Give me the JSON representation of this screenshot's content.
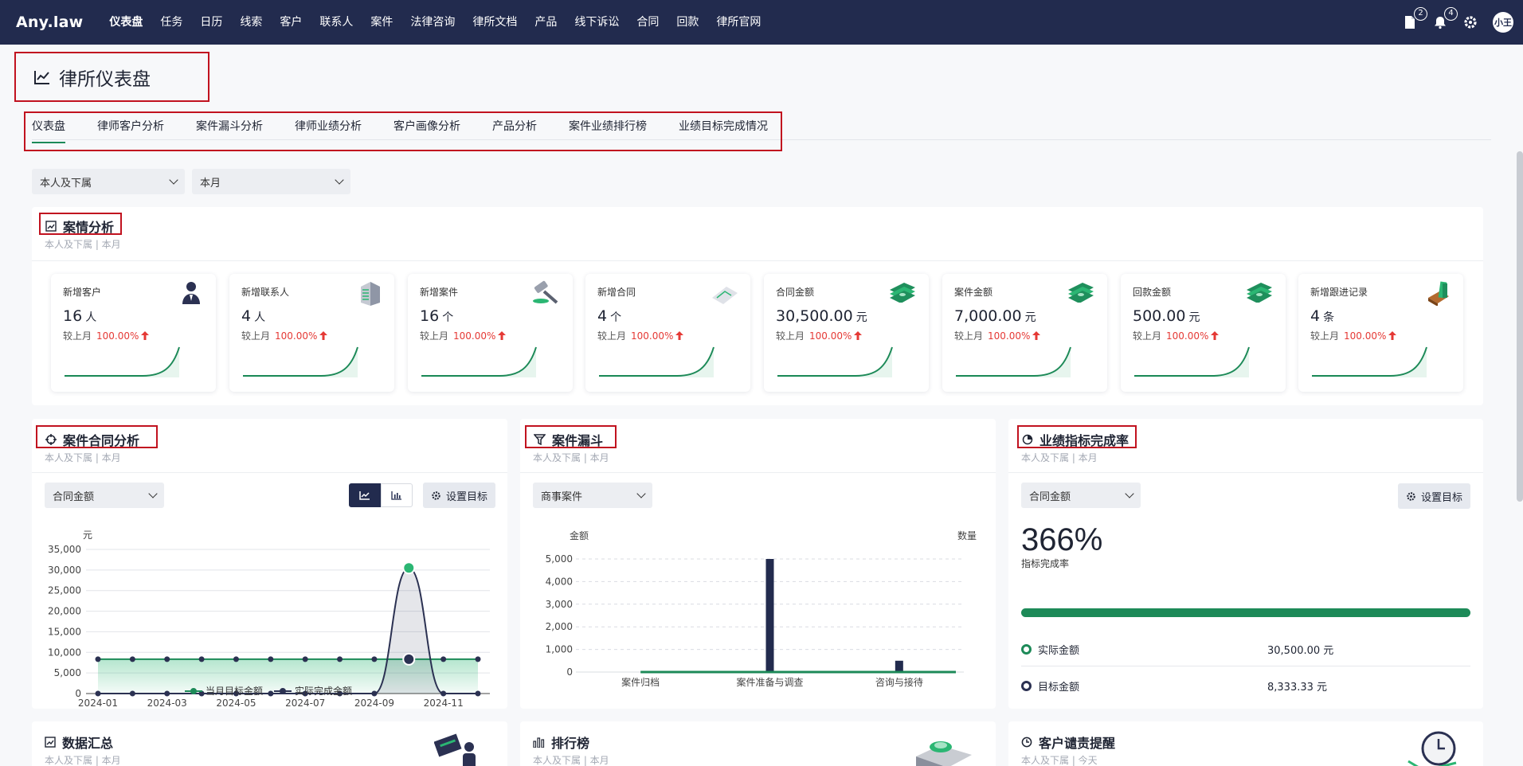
{
  "app": {
    "logo": "Any.law",
    "nav": [
      "仪表盘",
      "任务",
      "日历",
      "线索",
      "客户",
      "联系人",
      "案件",
      "法律咨询",
      "律所文档",
      "产品",
      "线下诉讼",
      "合同",
      "回款",
      "律所官网"
    ],
    "badges": {
      "docs": "2",
      "bell": "4"
    },
    "avatar": "小王"
  },
  "page": {
    "title": "律所仪表盘",
    "tabs": [
      "仪表盘",
      "律师客户分析",
      "案件漏斗分析",
      "律师业绩分析",
      "客户画像分析",
      "产品分析",
      "案件业绩排行榜",
      "业绩目标完成情况"
    ],
    "filter_scope": "本人及下属",
    "filter_period": "本月"
  },
  "case_analysis": {
    "title": "案情分析",
    "subtitle": "本人及下属 | 本月",
    "compare_label": "较上月",
    "stats": [
      {
        "label": "新增客户",
        "value": "16",
        "unit": "人",
        "change": "100.00%",
        "icon": "lawyer-person-icon"
      },
      {
        "label": "新增联系人",
        "value": "4",
        "unit": "人",
        "change": "100.00%",
        "icon": "building-icon"
      },
      {
        "label": "新增案件",
        "value": "16",
        "unit": "个",
        "change": "100.00%",
        "icon": "gavel-icon"
      },
      {
        "label": "新增合同",
        "value": "4",
        "unit": "个",
        "change": "100.00%",
        "icon": "contract-icon"
      },
      {
        "label": "合同金额",
        "value": "30,500.00",
        "unit": "元",
        "change": "100.00%",
        "icon": "cash-icon"
      },
      {
        "label": "案件金额",
        "value": "7,000.00",
        "unit": "元",
        "change": "100.00%",
        "icon": "cash-icon"
      },
      {
        "label": "回款金额",
        "value": "500.00",
        "unit": "元",
        "change": "100.00%",
        "icon": "cash-icon"
      },
      {
        "label": "新增跟进记录",
        "value": "4",
        "unit": "条",
        "change": "100.00%",
        "icon": "books-icon"
      }
    ]
  },
  "contract_analysis": {
    "title": "案件合同分析",
    "subtitle": "本人及下属 | 本月",
    "select": "合同金额",
    "set_target": "设置目标",
    "unit_label": "元",
    "legend": [
      "当月目标金额",
      "实际完成金额"
    ],
    "colors": {
      "target": "#1d8a58",
      "actual": "#2b3152"
    }
  },
  "funnel": {
    "title": "案件漏斗",
    "subtitle": "本人及下属 | 本月",
    "select": "商事案件",
    "left_axis": "金额",
    "right_axis": "数量"
  },
  "kpi": {
    "title": "业绩指标完成率",
    "subtitle": "本人及下属 | 本月",
    "select": "合同金额",
    "set_target": "设置目标",
    "percent": "366%",
    "percent_label": "指标完成率",
    "progress": 1.0,
    "actual_label": "实际金额",
    "actual_value": "30,500.00 元",
    "target_label": "目标金额",
    "target_value": "8,333.33 元"
  },
  "bottom": {
    "summary_title": "数据汇总",
    "summary_sub": "本人及下属 | 本月",
    "ranking_title": "排行榜",
    "ranking_sub": "本人及下属 | 本月",
    "reminder_title": "客户谴责提醒",
    "reminder_sub": "本人及下属 | 今天"
  },
  "chart_data": [
    {
      "type": "line",
      "x": [
        "2024-01",
        "2024-02",
        "2024-03",
        "2024-04",
        "2024-05",
        "2024-06",
        "2024-07",
        "2024-08",
        "2024-09",
        "2024-10",
        "2024-11",
        "2024-12"
      ],
      "x_tick_labels": [
        "2024-01",
        "2024-03",
        "2024-05",
        "2024-07",
        "2024-09",
        "2024-11"
      ],
      "series": [
        {
          "name": "当月目标金额",
          "values": [
            8333,
            8333,
            8333,
            8333,
            8333,
            8333,
            8333,
            8333,
            8333,
            8333,
            8333,
            8333
          ]
        },
        {
          "name": "实际完成金额",
          "values": [
            0,
            0,
            0,
            0,
            0,
            0,
            0,
            0,
            0,
            30500,
            0,
            0
          ]
        }
      ],
      "ylabel": "元",
      "ylim": [
        0,
        35000
      ],
      "yticks": [
        "0",
        "5,000",
        "10,000",
        "15,000",
        "20,000",
        "25,000",
        "30,000",
        "35,000"
      ],
      "grid": true,
      "legend": "bottom"
    },
    {
      "type": "bar",
      "categories": [
        "案件归档",
        "案件准备与调查",
        "咨询与接待"
      ],
      "series": [
        {
          "name": "金额",
          "values": [
            0,
            5000,
            500
          ]
        }
      ],
      "ylabel": "金额",
      "y2label": "数量",
      "ylim": [
        0,
        5000
      ],
      "yticks": [
        "0",
        "1,000",
        "2,000",
        "3,000",
        "4,000",
        "5,000"
      ],
      "grid": true
    }
  ]
}
